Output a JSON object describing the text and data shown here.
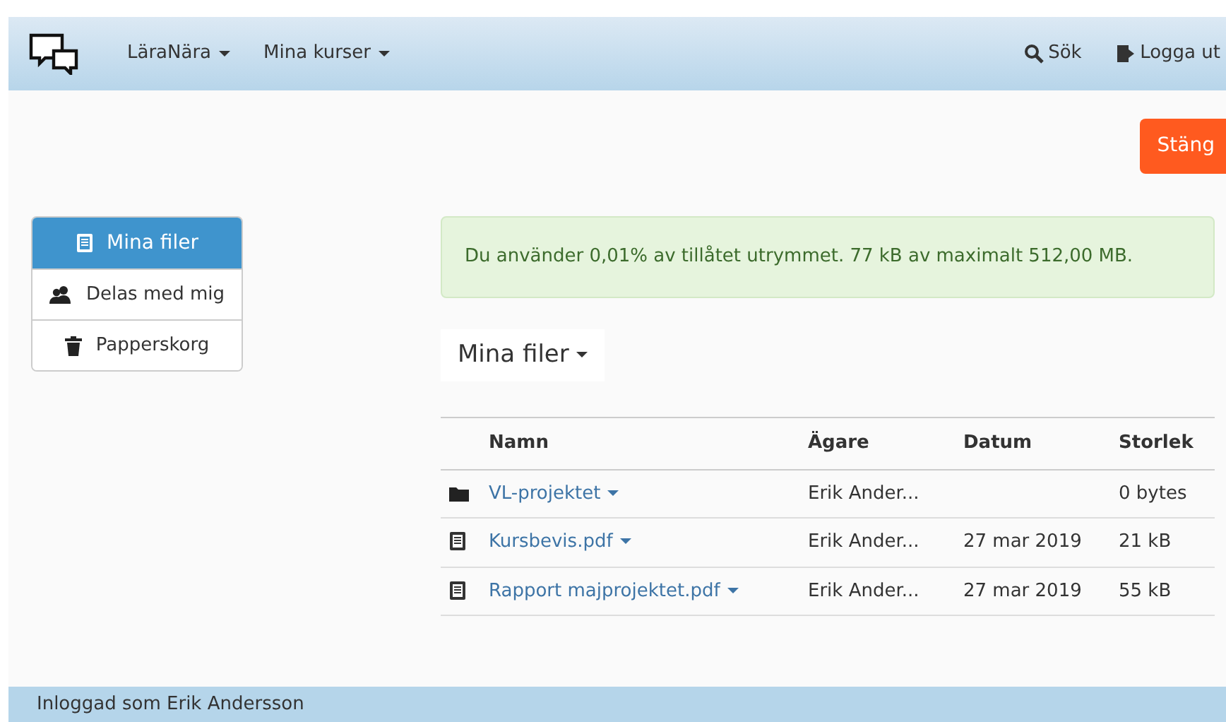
{
  "navbar": {
    "menus": [
      {
        "label": "LäraNära"
      },
      {
        "label": "Mina kurser"
      }
    ],
    "actions": [
      {
        "label": "Sök"
      },
      {
        "label": "Logga ut"
      }
    ]
  },
  "close_button": "Stäng",
  "sidebar": {
    "items": [
      {
        "label": "Mina filer",
        "selected": true
      },
      {
        "label": "Delas med mig",
        "selected": false
      },
      {
        "label": "Papperskorg",
        "selected": false
      }
    ]
  },
  "alert": "Du använder 0,01% av tillåtet utrymmet. 77 kB av maximalt 512,00 MB.",
  "folder_menu": "Mina filer",
  "table": {
    "columns": [
      "Namn",
      "Ägare",
      "Datum",
      "Storlek"
    ],
    "rows": [
      {
        "kind": "folder",
        "name": "VL-projektet",
        "owner": "Erik Ander...",
        "size": "0 bytes"
      },
      {
        "kind": "file",
        "name": "Kursbevis.pdf",
        "owner": "Erik Ander...",
        "date": "27 mar 2019",
        "size": "21 kB"
      },
      {
        "kind": "file",
        "name": "Rapport majprojektet.pdf",
        "owner": "Erik Ander...",
        "date": "27 mar 2019",
        "size": "55 kB"
      }
    ]
  },
  "footer": "Inloggad som Erik Andersson"
}
